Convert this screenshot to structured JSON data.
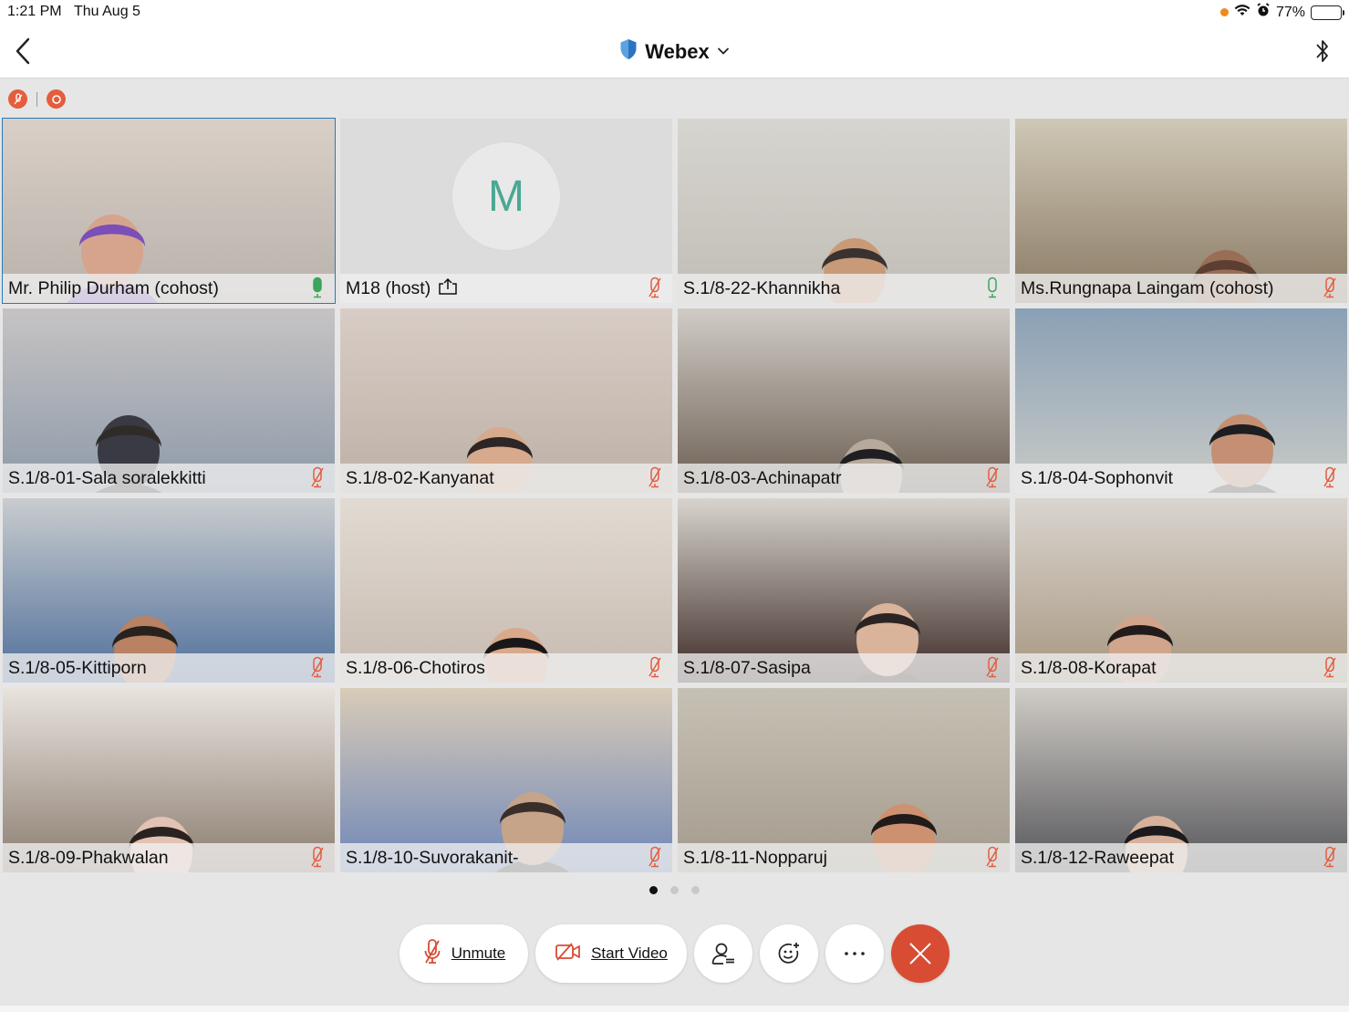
{
  "status_bar": {
    "time": "1:21 PM",
    "date": "Thu Aug 5",
    "battery": "77%",
    "battery_level": 0.77
  },
  "header": {
    "title": "Webex",
    "icons": [
      "chevron-left-icon",
      "shield-icon",
      "chevron-down-icon",
      "bluetooth-icon"
    ]
  },
  "indicators": [
    "muted-indicator-icon",
    "recording-indicator-icon"
  ],
  "colors": {
    "accent_blue": "#2a79b6",
    "mute_red": "#e35d3f",
    "mic_green": "#3aa55b",
    "end_red": "#d84c34",
    "avatar_text": "#4aa894"
  },
  "participants": [
    {
      "name": "Mr. Philip Durham (cohost)",
      "mic": "on",
      "active": true
    },
    {
      "name": "M18 (host)",
      "mic": "muted",
      "avatar": "M",
      "sharing": true
    },
    {
      "name": "S.1/8-22-Khannikha",
      "mic": "on"
    },
    {
      "name": "Ms.Rungnapa Laingam (cohost)",
      "mic": "muted"
    },
    {
      "name": "S.1/8-01-Sala soralekkitti",
      "mic": "muted"
    },
    {
      "name": "S.1/8-02-Kanyanat",
      "mic": "muted"
    },
    {
      "name": "S.1/8-03-Achinapatr",
      "mic": "muted"
    },
    {
      "name": "S.1/8-04-Sophonvit",
      "mic": "muted"
    },
    {
      "name": "S.1/8-05-Kittiporn",
      "mic": "muted"
    },
    {
      "name": "S.1/8-06-Chotiros",
      "mic": "muted"
    },
    {
      "name": "S.1/8-07-Sasipa",
      "mic": "muted"
    },
    {
      "name": "S.1/8-08-Korapat",
      "mic": "muted"
    },
    {
      "name": "S.1/8-09-Phakwalan",
      "mic": "muted"
    },
    {
      "name": "S.1/8-10-Suvorakanit-",
      "mic": "muted"
    },
    {
      "name": "S.1/8-11-Nopparuj",
      "mic": "muted"
    },
    {
      "name": "S.1/8-12-Raweepat",
      "mic": "muted"
    }
  ],
  "pager": {
    "pages": 3,
    "current": 1
  },
  "controls": {
    "unmute_label": "Unmute",
    "start_video_label": "Start Video",
    "icons": [
      "mic-off-icon",
      "video-off-icon",
      "participants-icon",
      "reactions-icon",
      "more-icon",
      "end-call-icon"
    ]
  }
}
